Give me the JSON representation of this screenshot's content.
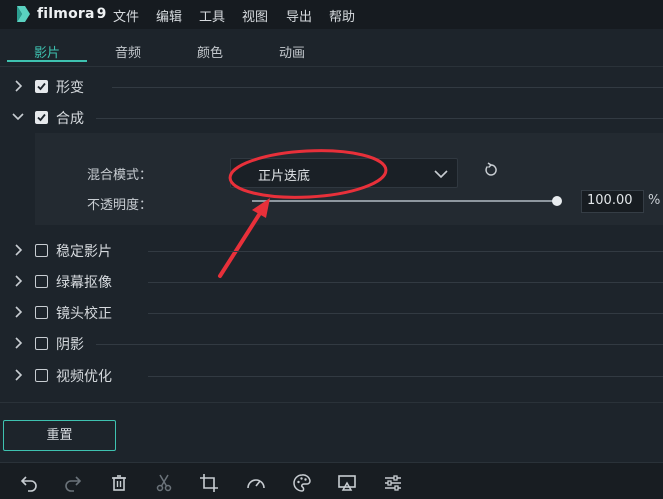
{
  "app": {
    "logo_text": "filmora",
    "logo_version": "9",
    "menu": [
      "文件",
      "编辑",
      "工具",
      "视图",
      "导出",
      "帮助"
    ]
  },
  "tabs": [
    {
      "label": "影片",
      "active": true
    },
    {
      "label": "音频",
      "active": false
    },
    {
      "label": "颜色",
      "active": false
    },
    {
      "label": "动画",
      "active": false
    }
  ],
  "sections": [
    {
      "label": "形变",
      "checked": true,
      "expanded": false
    },
    {
      "label": "合成",
      "checked": true,
      "expanded": true
    },
    {
      "label": "稳定影片",
      "checked": false,
      "expanded": false
    },
    {
      "label": "绿幕抠像",
      "checked": false,
      "expanded": false
    },
    {
      "label": "镜头校正",
      "checked": false,
      "expanded": false
    },
    {
      "label": "阴影",
      "checked": false,
      "expanded": false
    },
    {
      "label": "视频优化",
      "checked": false,
      "expanded": false
    }
  ],
  "composite": {
    "blend_label": "混合模式：",
    "blend_value": "正片迭底",
    "opacity_label": "不透明度：",
    "opacity_value": "100.00",
    "opacity_unit": "%",
    "opacity_fraction": 1.0
  },
  "reset_label": "重置",
  "toolbar_icons": [
    "undo-icon",
    "redo-icon",
    "trash-icon",
    "scissors-icon",
    "crop-icon",
    "speed-icon",
    "color-palette-icon",
    "screen-icon",
    "adjust-icon"
  ],
  "colors": {
    "accent": "#3ec2b0",
    "annotation": "#e8303a",
    "background": "#1d242b"
  }
}
